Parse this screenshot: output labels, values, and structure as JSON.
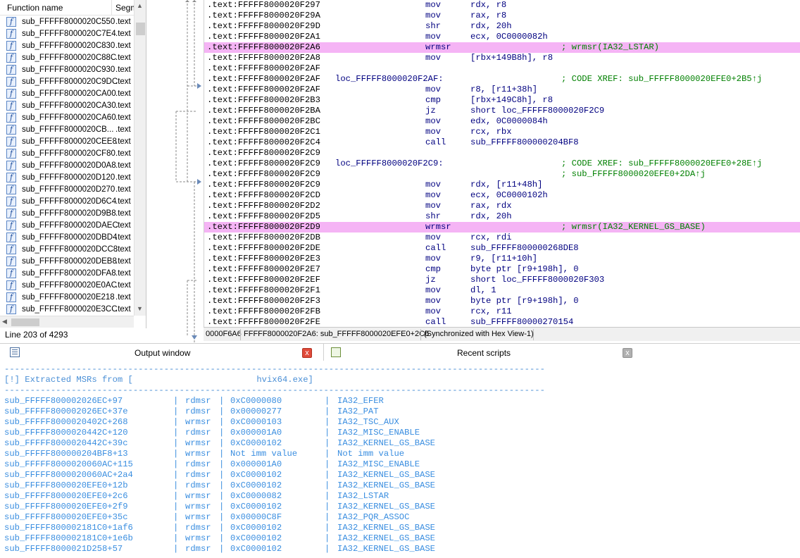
{
  "function_panel": {
    "header_name": "Function name",
    "header_segment": "Segm",
    "functions": [
      {
        "name": "sub_FFFFF8000020C550",
        "segment": ".text"
      },
      {
        "name": "sub_FFFFF8000020C7E4",
        "segment": ".text"
      },
      {
        "name": "sub_FFFFF8000020C830",
        "segment": ".text"
      },
      {
        "name": "sub_FFFFF8000020C88C",
        "segment": ".text"
      },
      {
        "name": "sub_FFFFF8000020C930",
        "segment": ".text"
      },
      {
        "name": "sub_FFFFF8000020C9DC",
        "segment": ".text"
      },
      {
        "name": "sub_FFFFF8000020CA00",
        "segment": ".text"
      },
      {
        "name": "sub_FFFFF8000020CA30",
        "segment": ".text"
      },
      {
        "name": "sub_FFFFF8000020CA60",
        "segment": ".text"
      },
      {
        "name": "sub_FFFFF8000020CB...",
        "segment": ".text"
      },
      {
        "name": "sub_FFFFF8000020CEE8",
        "segment": ".text"
      },
      {
        "name": "sub_FFFFF8000020CF80",
        "segment": ".text"
      },
      {
        "name": "sub_FFFFF8000020D0A8",
        "segment": ".text"
      },
      {
        "name": "sub_FFFFF8000020D120",
        "segment": ".text"
      },
      {
        "name": "sub_FFFFF8000020D270",
        "segment": ".text"
      },
      {
        "name": "sub_FFFFF8000020D6C4",
        "segment": ".text"
      },
      {
        "name": "sub_FFFFF8000020D9B8",
        "segment": ".text"
      },
      {
        "name": "sub_FFFFF8000020DAEC",
        "segment": ".text"
      },
      {
        "name": "sub_FFFFF8000020DBD4",
        "segment": ".text"
      },
      {
        "name": "sub_FFFFF8000020DCC8",
        "segment": ".text"
      },
      {
        "name": "sub_FFFFF8000020DEB8",
        "segment": ".text"
      },
      {
        "name": "sub_FFFFF8000020DFA8",
        "segment": ".text"
      },
      {
        "name": "sub_FFFFF8000020E0AC",
        "segment": ".text"
      },
      {
        "name": "sub_FFFFF8000020E218",
        "segment": ".text"
      },
      {
        "name": "sub_FFFFF8000020E3CC",
        "segment": ".text"
      }
    ],
    "line_info": "Line 203 of 4293"
  },
  "disassembly": {
    "rows": [
      {
        "addr": ".text:FFFFF8000020F297",
        "label": "",
        "mnemonic": "mov",
        "operands": "rdx, r8",
        "comment": "",
        "highlight": false
      },
      {
        "addr": ".text:FFFFF8000020F29A",
        "label": "",
        "mnemonic": "mov",
        "operands": "rax, r8",
        "comment": "",
        "highlight": false
      },
      {
        "addr": ".text:FFFFF8000020F29D",
        "label": "",
        "mnemonic": "shr",
        "operands": "rdx, 20h",
        "comment": "",
        "highlight": false
      },
      {
        "addr": ".text:FFFFF8000020F2A1",
        "label": "",
        "mnemonic": "mov",
        "operands": "ecx, 0C0000082h",
        "comment": "",
        "highlight": false
      },
      {
        "addr": ".text:FFFFF8000020F2A6",
        "label": "",
        "mnemonic": "wrmsr",
        "operands": "",
        "comment": "; wrmsr(IA32_LSTAR)",
        "highlight": true
      },
      {
        "addr": ".text:FFFFF8000020F2A8",
        "label": "",
        "mnemonic": "mov",
        "operands": "[rbx+149B8h], r8",
        "comment": "",
        "highlight": false
      },
      {
        "addr": ".text:FFFFF8000020F2AF",
        "label": "",
        "mnemonic": "",
        "operands": "",
        "comment": "",
        "highlight": false
      },
      {
        "addr": ".text:FFFFF8000020F2AF",
        "label": "loc_FFFFF8000020F2AF:",
        "mnemonic": "",
        "operands": "",
        "comment": "; CODE XREF: sub_FFFFF8000020EFE0+2B5↑j",
        "highlight": false
      },
      {
        "addr": ".text:FFFFF8000020F2AF",
        "label": "",
        "mnemonic": "mov",
        "operands": "r8, [r11+38h]",
        "comment": "",
        "highlight": false
      },
      {
        "addr": ".text:FFFFF8000020F2B3",
        "label": "",
        "mnemonic": "cmp",
        "operands": "[rbx+149C8h], r8",
        "comment": "",
        "highlight": false
      },
      {
        "addr": ".text:FFFFF8000020F2BA",
        "label": "",
        "mnemonic": "jz",
        "operands": "short loc_FFFFF8000020F2C9",
        "comment": "",
        "highlight": false
      },
      {
        "addr": ".text:FFFFF8000020F2BC",
        "label": "",
        "mnemonic": "mov",
        "operands": "edx, 0C0000084h",
        "comment": "",
        "highlight": false
      },
      {
        "addr": ".text:FFFFF8000020F2C1",
        "label": "",
        "mnemonic": "mov",
        "operands": "rcx, rbx",
        "comment": "",
        "highlight": false
      },
      {
        "addr": ".text:FFFFF8000020F2C4",
        "label": "",
        "mnemonic": "call",
        "operands": "sub_FFFFF800000204BF8",
        "comment": "",
        "highlight": false
      },
      {
        "addr": ".text:FFFFF8000020F2C9",
        "label": "",
        "mnemonic": "",
        "operands": "",
        "comment": "",
        "highlight": false
      },
      {
        "addr": ".text:FFFFF8000020F2C9",
        "label": "loc_FFFFF8000020F2C9:",
        "mnemonic": "",
        "operands": "",
        "comment": "; CODE XREF: sub_FFFFF8000020EFE0+28E↑j",
        "highlight": false
      },
      {
        "addr": ".text:FFFFF8000020F2C9",
        "label": "",
        "mnemonic": "",
        "operands": "",
        "comment": "; sub_FFFFF8000020EFE0+2DA↑j",
        "highlight": false
      },
      {
        "addr": ".text:FFFFF8000020F2C9",
        "label": "",
        "mnemonic": "mov",
        "operands": "rdx, [r11+48h]",
        "comment": "",
        "highlight": false
      },
      {
        "addr": ".text:FFFFF8000020F2CD",
        "label": "",
        "mnemonic": "mov",
        "operands": "ecx, 0C0000102h",
        "comment": "",
        "highlight": false
      },
      {
        "addr": ".text:FFFFF8000020F2D2",
        "label": "",
        "mnemonic": "mov",
        "operands": "rax, rdx",
        "comment": "",
        "highlight": false
      },
      {
        "addr": ".text:FFFFF8000020F2D5",
        "label": "",
        "mnemonic": "shr",
        "operands": "rdx, 20h",
        "comment": "",
        "highlight": false
      },
      {
        "addr": ".text:FFFFF8000020F2D9",
        "label": "",
        "mnemonic": "wrmsr",
        "operands": "",
        "comment": "; wrmsr(IA32_KERNEL_GS_BASE)",
        "highlight": true
      },
      {
        "addr": ".text:FFFFF8000020F2DB",
        "label": "",
        "mnemonic": "mov",
        "operands": "rcx, rdi",
        "comment": "",
        "highlight": false
      },
      {
        "addr": ".text:FFFFF8000020F2DE",
        "label": "",
        "mnemonic": "call",
        "operands": "sub_FFFFF800000268DE8",
        "comment": "",
        "highlight": false
      },
      {
        "addr": ".text:FFFFF8000020F2E3",
        "label": "",
        "mnemonic": "mov",
        "operands": "r9, [r11+10h]",
        "comment": "",
        "highlight": false
      },
      {
        "addr": ".text:FFFFF8000020F2E7",
        "label": "",
        "mnemonic": "cmp",
        "operands": "byte ptr [r9+198h], 0",
        "comment": "",
        "highlight": false
      },
      {
        "addr": ".text:FFFFF8000020F2EF",
        "label": "",
        "mnemonic": "jz",
        "operands": "short loc_FFFFF8000020F303",
        "comment": "",
        "highlight": false
      },
      {
        "addr": ".text:FFFFF8000020F2F1",
        "label": "",
        "mnemonic": "mov",
        "operands": "dl, 1",
        "comment": "",
        "highlight": false
      },
      {
        "addr": ".text:FFFFF8000020F2F3",
        "label": "",
        "mnemonic": "mov",
        "operands": "byte ptr [r9+198h], 0",
        "comment": "",
        "highlight": false
      },
      {
        "addr": ".text:FFFFF8000020F2FB",
        "label": "",
        "mnemonic": "mov",
        "operands": "rcx, r11",
        "comment": "",
        "highlight": false
      },
      {
        "addr": ".text:FFFFF8000020F2FE",
        "label": "",
        "mnemonic": "call",
        "operands": "sub_FFFFF80000270154",
        "comment": "",
        "highlight": false
      }
    ],
    "status": {
      "offset": "0000F6A6",
      "location": "FFFFF8000020F2A6: sub_FFFFF8000020EFE0+2C6",
      "sync": "(Synchronized with Hex View-1)"
    }
  },
  "tabs": {
    "output_label": "Output window",
    "scripts_label": "Recent scripts",
    "close_glyph": "x"
  },
  "output": {
    "separator": "---------------------------------------------------------------------------------------------------------",
    "header": "[!] Extracted MSRs from [                        hvix64.exe]",
    "pipe": "|",
    "rows": [
      {
        "function": "sub_FFFFF800002026EC+97",
        "instruction": "rdmsr",
        "msr_id": "0xC0000080",
        "msr_name": "IA32_EFER"
      },
      {
        "function": "sub_FFFFF800002026EC+37e",
        "instruction": "rdmsr",
        "msr_id": "0x00000277",
        "msr_name": "IA32_PAT"
      },
      {
        "function": "sub_FFFFF8000020402C+268",
        "instruction": "wrmsr",
        "msr_id": "0xC0000103",
        "msr_name": "IA32_TSC_AUX"
      },
      {
        "function": "sub_FFFFF8000020442C+120",
        "instruction": "rdmsr",
        "msr_id": "0x000001A0",
        "msr_name": "IA32_MISC_ENABLE"
      },
      {
        "function": "sub_FFFFF8000020442C+39c",
        "instruction": "wrmsr",
        "msr_id": "0xC0000102",
        "msr_name": "IA32_KERNEL_GS_BASE"
      },
      {
        "function": "sub_FFFFF800000204BF8+13",
        "instruction": "wrmsr",
        "msr_id": "Not imm value",
        "msr_name": "Not imm value"
      },
      {
        "function": "sub_FFFFF8000020060AC+115",
        "instruction": "rdmsr",
        "msr_id": "0x000001A0",
        "msr_name": "IA32_MISC_ENABLE"
      },
      {
        "function": "sub_FFFFF8000020060AC+2a4",
        "instruction": "rdmsr",
        "msr_id": "0xC0000102",
        "msr_name": "IA32_KERNEL_GS_BASE"
      },
      {
        "function": "sub_FFFFF8000020EFE0+12b",
        "instruction": "rdmsr",
        "msr_id": "0xC0000102",
        "msr_name": "IA32_KERNEL_GS_BASE"
      },
      {
        "function": "sub_FFFFF8000020EFE0+2c6",
        "instruction": "wrmsr",
        "msr_id": "0xC0000082",
        "msr_name": "IA32_LSTAR"
      },
      {
        "function": "sub_FFFFF8000020EFE0+2f9",
        "instruction": "wrmsr",
        "msr_id": "0xC0000102",
        "msr_name": "IA32_KERNEL_GS_BASE"
      },
      {
        "function": "sub_FFFFF8000020EFE0+35c",
        "instruction": "wrmsr",
        "msr_id": "0x00000C8F",
        "msr_name": "IA32_PQR_ASSOC"
      },
      {
        "function": "sub_FFFFF800002181C0+1af6",
        "instruction": "rdmsr",
        "msr_id": "0xC0000102",
        "msr_name": "IA32_KERNEL_GS_BASE"
      },
      {
        "function": "sub_FFFFF800002181C0+1e6b",
        "instruction": "wrmsr",
        "msr_id": "0xC0000102",
        "msr_name": "IA32_KERNEL_GS_BASE"
      },
      {
        "function": "sub_FFFFF8000021D258+57",
        "instruction": "rdmsr",
        "msr_id": "0xC0000102",
        "msr_name": "IA32_KERNEL_GS_BASE"
      }
    ]
  }
}
